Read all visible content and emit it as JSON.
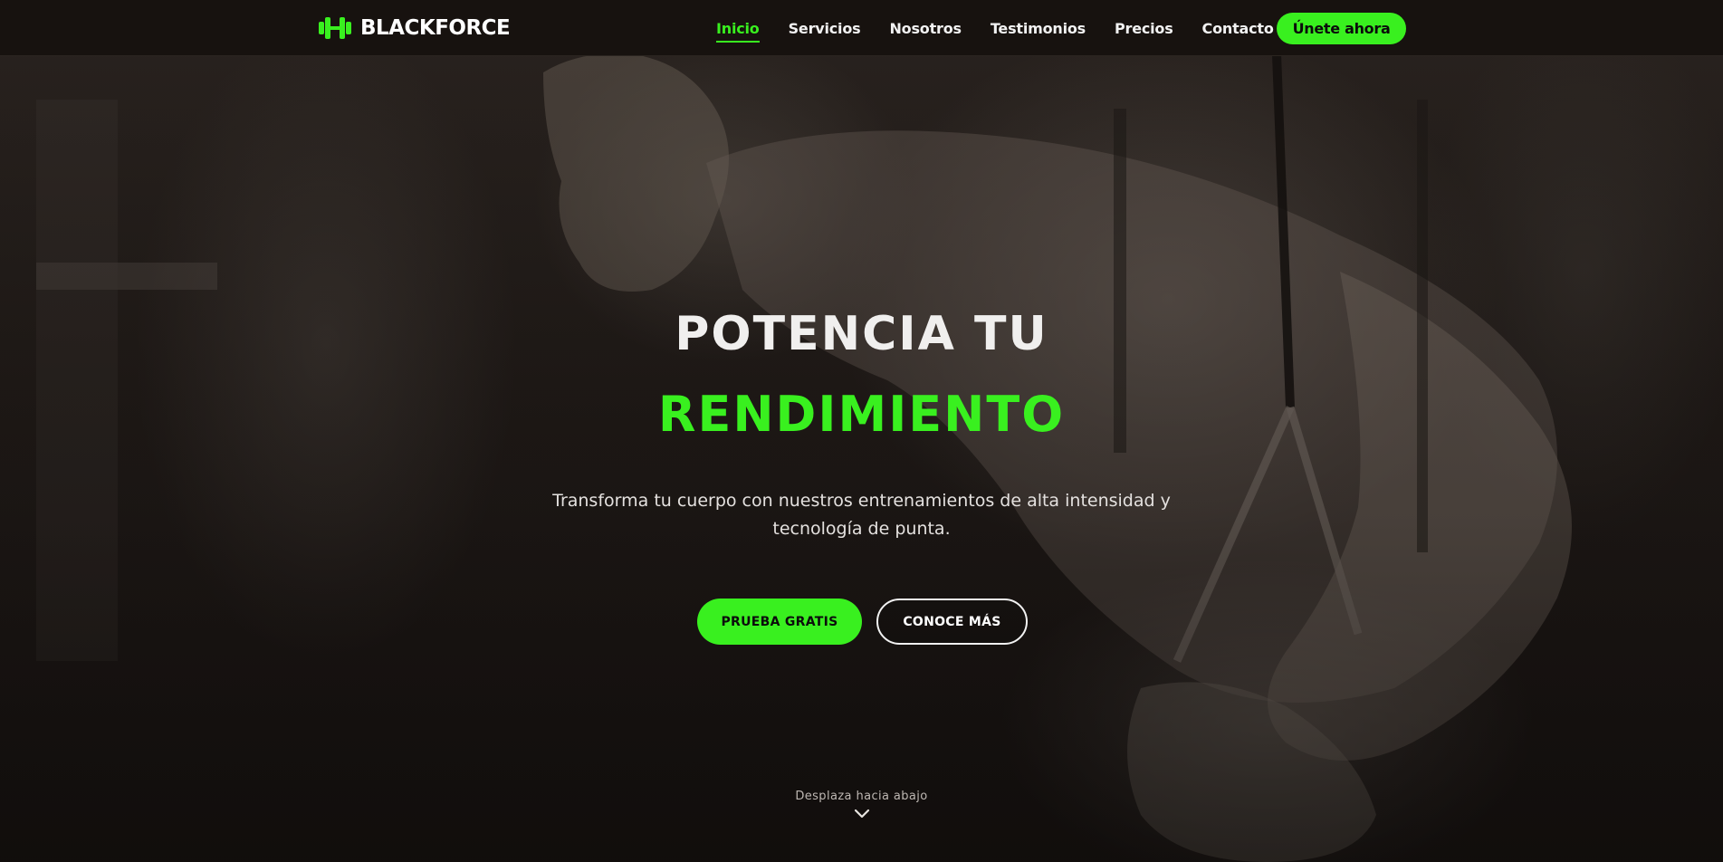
{
  "brand": {
    "name": "BLACKFORCE",
    "logo_icon": "dumbbell-icon",
    "accent_color": "#39f01f"
  },
  "nav": {
    "items": [
      {
        "label": "Inicio",
        "active": true
      },
      {
        "label": "Servicios",
        "active": false
      },
      {
        "label": "Nosotros",
        "active": false
      },
      {
        "label": "Testimonios",
        "active": false
      },
      {
        "label": "Precios",
        "active": false
      },
      {
        "label": "Contacto",
        "active": false
      }
    ],
    "cta_label": "Únete ahora"
  },
  "hero": {
    "title_line1": "POTENCIA TU",
    "title_line2": "RENDIMIENTO",
    "subtitle": "Transforma tu cuerpo con nuestros entrenamientos de alta intensidad y tecnología de punta.",
    "primary_button": "PRUEBA GRATIS",
    "secondary_button": "CONOCE MÁS",
    "scroll_label": "Desplaza hacia abajo",
    "scroll_icon": "chevron-down-icon"
  }
}
